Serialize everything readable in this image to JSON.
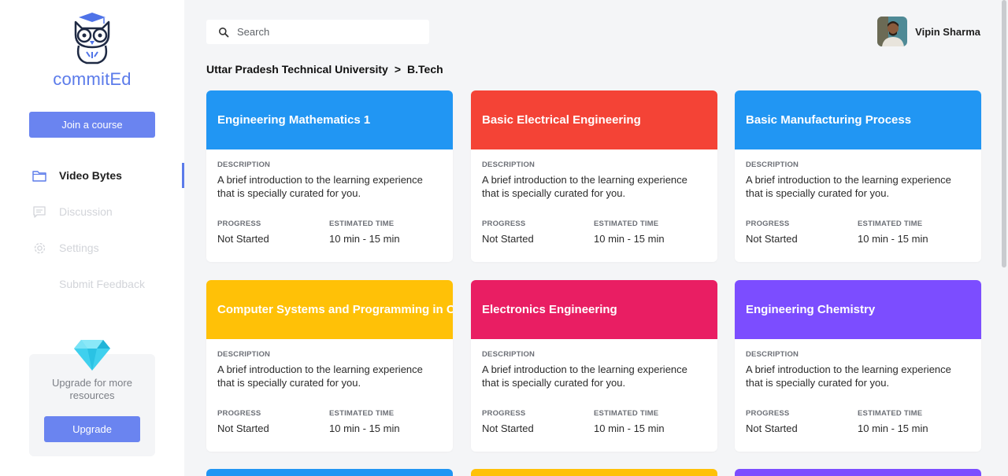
{
  "brand": {
    "name": "commitEd",
    "logo_icon": "owl-graduate-icon"
  },
  "sidebar": {
    "join_label": "Join a course",
    "items": [
      {
        "label": "Video Bytes",
        "icon": "folder-icon",
        "active": true
      },
      {
        "label": "Discussion",
        "icon": "chat-icon",
        "active": false
      },
      {
        "label": "Settings",
        "icon": "gear-icon",
        "active": false
      },
      {
        "label": "Submit Feedback",
        "icon": "",
        "active": false
      }
    ],
    "upgrade": {
      "text": "Upgrade for more resources",
      "button_label": "Upgrade",
      "icon": "diamond-icon"
    }
  },
  "search": {
    "placeholder": "Search"
  },
  "user": {
    "name": "Vipin Sharma"
  },
  "breadcrumb": {
    "parent": "Uttar Pradesh Technical University",
    "separator": ">",
    "current": "B.Tech"
  },
  "card_labels": {
    "description": "DESCRIPTION",
    "progress": "PROGRESS",
    "estimated": "ESTIMATED TIME"
  },
  "courses": [
    {
      "title": "Engineering Mathematics 1",
      "color": "#2196f3",
      "description": "A brief introduction to the learning experience that is specially curated for you.",
      "progress": "Not Started",
      "time": "10 min - 15 min"
    },
    {
      "title": "Basic Electrical Engineering",
      "color": "#f44336",
      "description": "A brief introduction to the learning experience that is specially curated for you.",
      "progress": "Not Started",
      "time": "10 min - 15 min"
    },
    {
      "title": "Basic Manufacturing Process",
      "color": "#2196f3",
      "description": "A brief introduction to the learning experience that is specially curated for you.",
      "progress": "Not Started",
      "time": "10 min - 15 min"
    },
    {
      "title": "Computer Systems and Programming in C",
      "color": "#ffc107",
      "description": "A brief introduction to the learning experience that is specially curated for you.",
      "progress": "Not Started",
      "time": "10 min - 15 min"
    },
    {
      "title": "Electronics Engineering",
      "color": "#e91e63",
      "description": "A brief introduction to the learning experience that is specially curated for you.",
      "progress": "Not Started",
      "time": "10 min - 15 min"
    },
    {
      "title": "Engineering Chemistry",
      "color": "#7c4dff",
      "description": "A brief introduction to the learning experience that is specially curated for you.",
      "progress": "Not Started",
      "time": "10 min - 15 min"
    }
  ],
  "partial_cards": [
    {
      "color": "#2196f3"
    },
    {
      "color": "#ffc107"
    },
    {
      "color": "#7c4dff"
    }
  ]
}
